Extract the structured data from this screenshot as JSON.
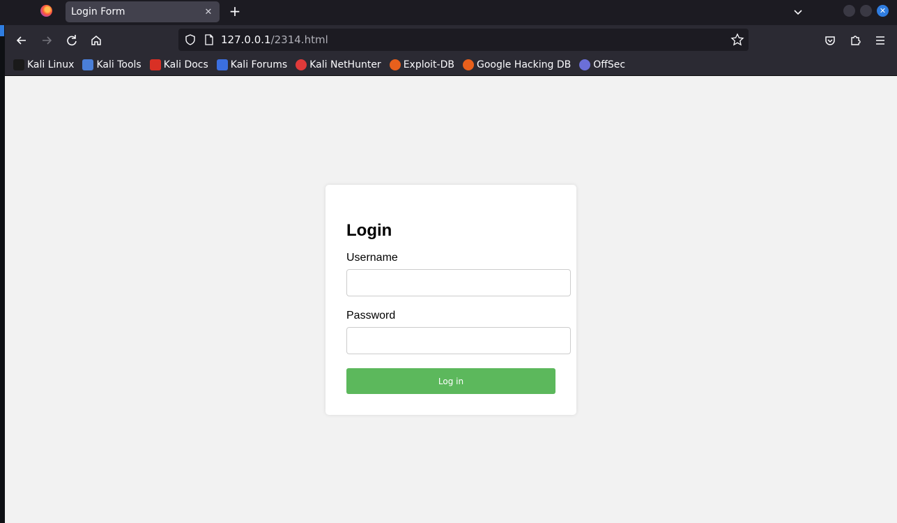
{
  "browser": {
    "tab_title": "Login Form",
    "url_host": "127.0.0.1",
    "url_path": "/2314.html"
  },
  "bookmarks": [
    {
      "label": "Kali Linux",
      "icon": "kali-dragon-icon",
      "color": "#1a1a1a"
    },
    {
      "label": "Kali Tools",
      "icon": "kali-tools-icon",
      "color": "#4a7fd8"
    },
    {
      "label": "Kali Docs",
      "icon": "kali-docs-icon",
      "color": "#d93025"
    },
    {
      "label": "Kali Forums",
      "icon": "kali-forums-icon",
      "color": "#3b6fe0"
    },
    {
      "label": "Kali NetHunter",
      "icon": "nethunter-icon",
      "color": "#e03a3a"
    },
    {
      "label": "Exploit-DB",
      "icon": "exploit-db-icon",
      "color": "#e8601c"
    },
    {
      "label": "Google Hacking DB",
      "icon": "ghdb-icon",
      "color": "#e8601c"
    },
    {
      "label": "OffSec",
      "icon": "offsec-icon",
      "color": "#6b6fd8"
    }
  ],
  "form": {
    "title": "Login",
    "username_label": "Username",
    "username_value": "",
    "password_label": "Password",
    "password_value": "",
    "submit_label": "Log in"
  },
  "colors": {
    "button": "#5cb85c",
    "page_bg": "#f2f2f2",
    "accent": "#2f7de1"
  }
}
